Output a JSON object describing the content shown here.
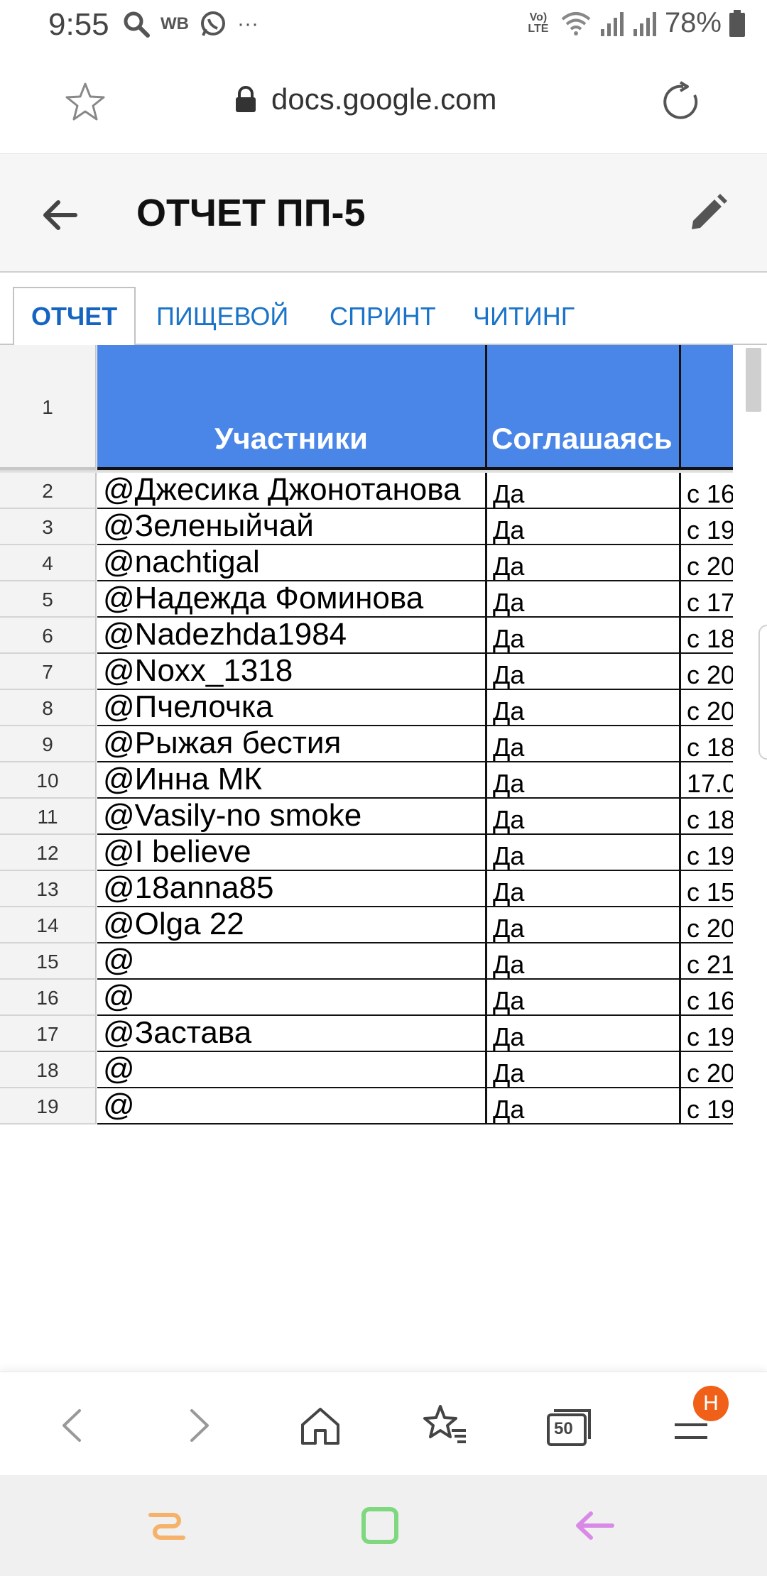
{
  "status_bar": {
    "time": "9:55",
    "wb_label": "WB",
    "lte_label": "Vo) LTE",
    "battery": "78%"
  },
  "url_bar": {
    "domain": "docs.google.com"
  },
  "doc": {
    "title": "ОТЧЕТ ПП-5"
  },
  "tabs": [
    {
      "label": "ОТЧЕТ",
      "active": true
    },
    {
      "label": "ПИЩЕВОЙ",
      "active": false
    },
    {
      "label": "СПРИНТ",
      "active": false
    },
    {
      "label": "ЧИТИНГ",
      "active": false
    }
  ],
  "sheet": {
    "header_row_number": "1",
    "columns": [
      "Участники",
      "Соглашаясь",
      ""
    ],
    "rows": [
      {
        "n": "2",
        "a": "@Джесика Джонотанова",
        "b": "Да",
        "c": "с 16"
      },
      {
        "n": "3",
        "a": "@Зеленыйчай",
        "b": "Да",
        "c": "с 19"
      },
      {
        "n": "4",
        "a": "@nachtigal",
        "b": "Да",
        "c": "с 20"
      },
      {
        "n": "5",
        "a": "@Надежда Фоминова",
        "b": "Да",
        "c": "с 17"
      },
      {
        "n": "6",
        "a": "@Nadezhda1984",
        "b": "Да",
        "c": "с 18"
      },
      {
        "n": "7",
        "a": "@Noxx_1318",
        "b": "Да",
        "c": "с 20"
      },
      {
        "n": "8",
        "a": "@Пчелочка",
        "b": "Да",
        "c": "с 20"
      },
      {
        "n": "9",
        "a": "@Рыжая бестия",
        "b": "Да",
        "c": "с 18"
      },
      {
        "n": "10",
        "a": "@Инна МК",
        "b": "Да",
        "c": "17.0"
      },
      {
        "n": "11",
        "a": "@Vasily-no smoke",
        "b": "Да",
        "c": "с 18"
      },
      {
        "n": "12",
        "a": "@I believe",
        "b": "Да",
        "c": "с 19"
      },
      {
        "n": "13",
        "a": "@18anna85",
        "b": "Да",
        "c": "с 15"
      },
      {
        "n": "14",
        "a": "@Olga 22",
        "b": "Да",
        "c": "с 20"
      },
      {
        "n": "15",
        "a": "@",
        "b": "Да",
        "c": "с 21"
      },
      {
        "n": "16",
        "a": "@",
        "b": "Да",
        "c": "с 16"
      },
      {
        "n": "17",
        "a": "@Застава",
        "b": "Да",
        "c": "с 19"
      },
      {
        "n": "18",
        "a": "@",
        "b": "Да",
        "c": "с 20"
      },
      {
        "n": "19",
        "a": "@",
        "b": "Да",
        "c": "с 19"
      }
    ]
  },
  "browser_bar": {
    "tab_count": "50",
    "badge": "H"
  },
  "colors": {
    "header_fill": "#4a86e8",
    "tab_text": "#1565c0",
    "badge": "#f06018"
  }
}
